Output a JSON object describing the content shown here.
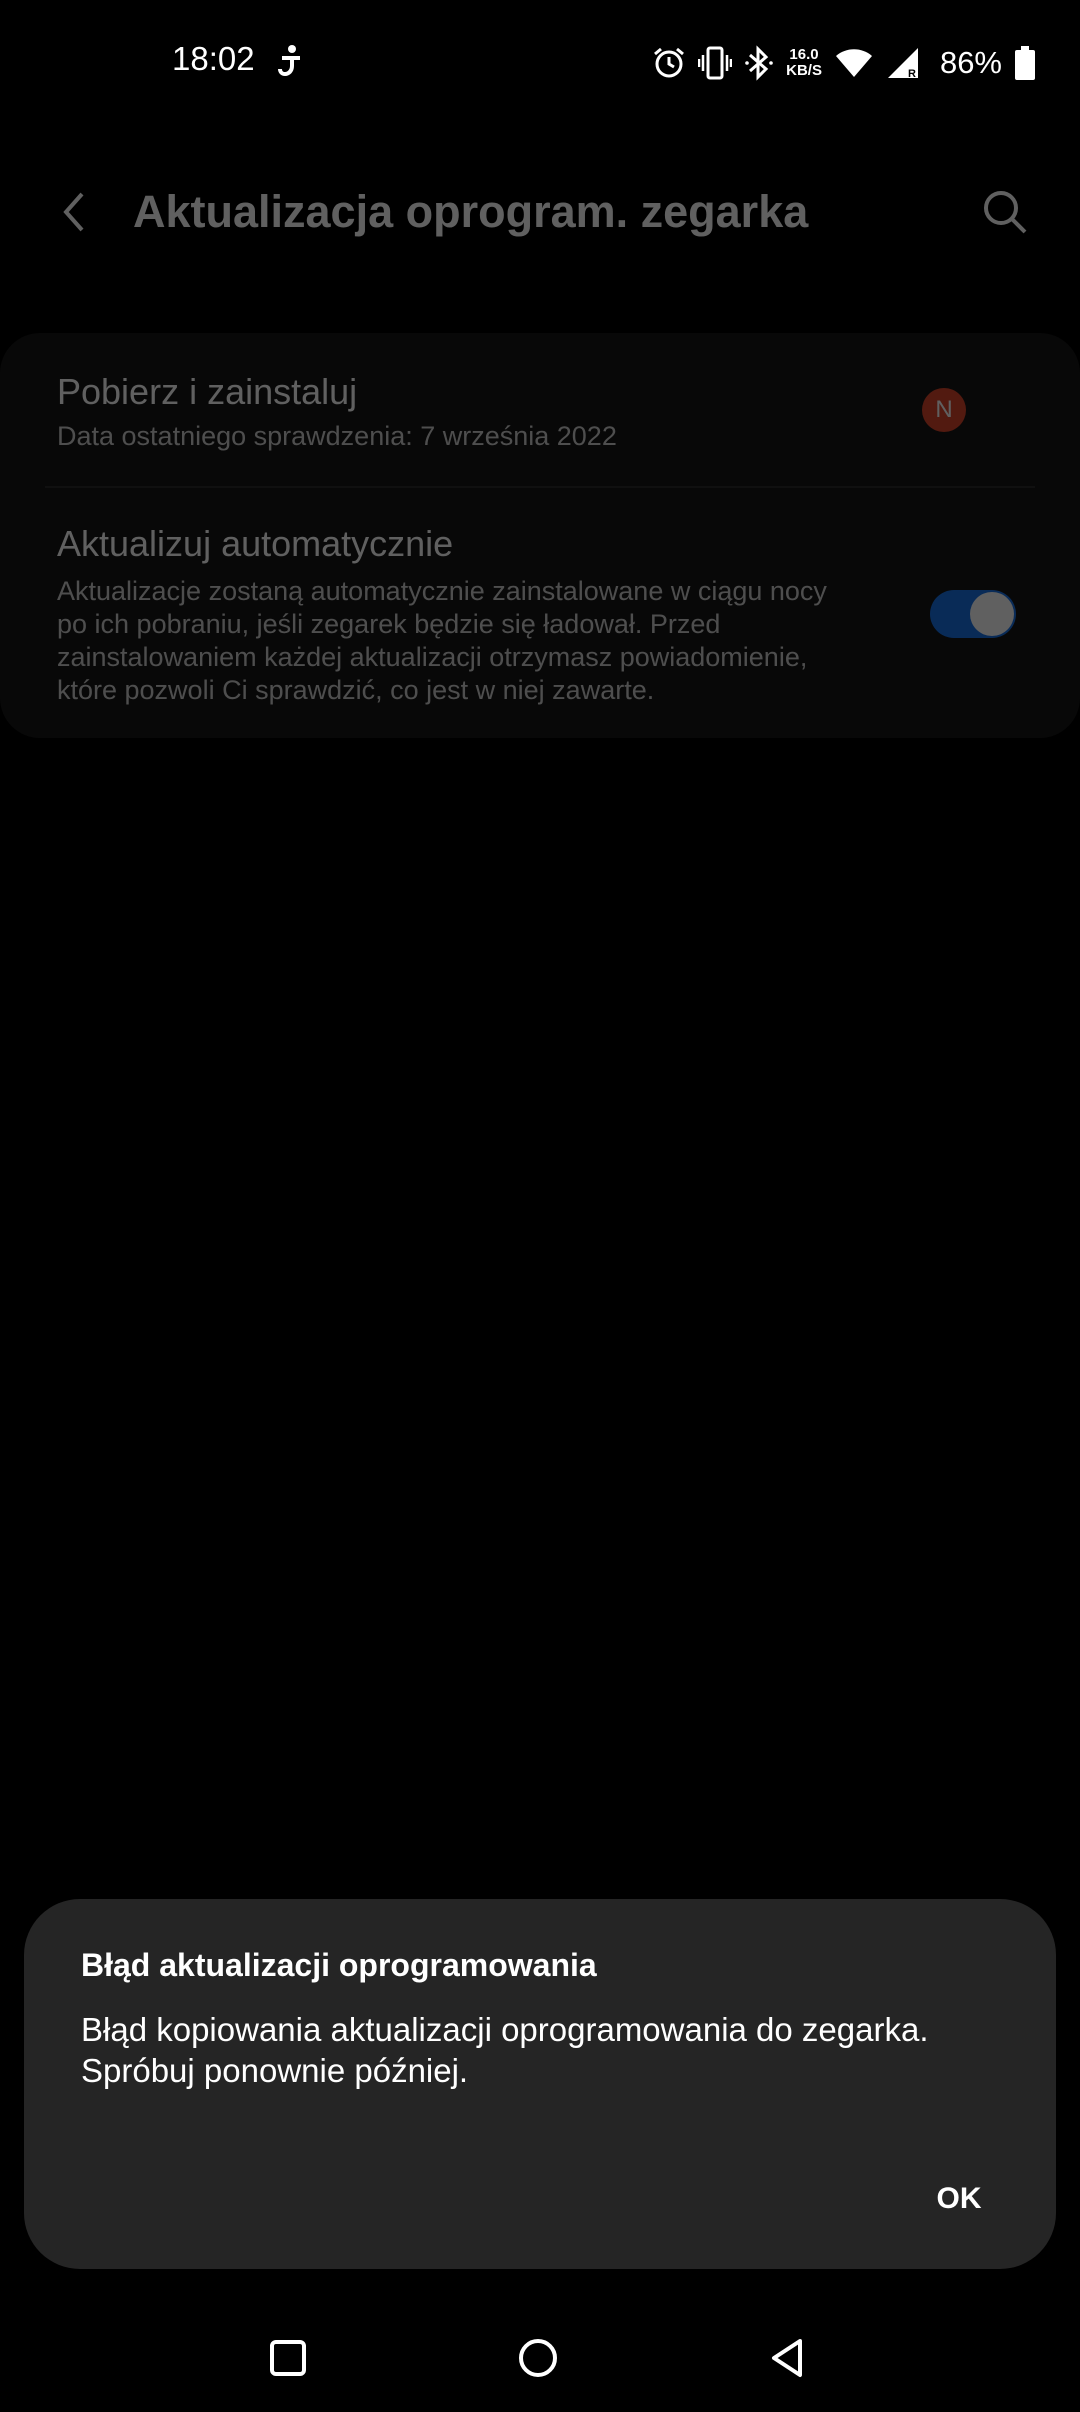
{
  "status_bar": {
    "time": "18:02",
    "net_speed_value": "16.0",
    "net_speed_unit": "KB/S",
    "battery_percent": "86%",
    "icons": [
      "accessibility-icon",
      "alarm-icon",
      "vibrate-icon",
      "bluetooth-icon",
      "wifi-icon",
      "cell-signal-icon",
      "battery-icon"
    ]
  },
  "header": {
    "title": "Aktualizacja oprogram. zegarka"
  },
  "settings": {
    "download": {
      "title": "Pobierz i zainstaluj",
      "subtitle": "Data ostatniego sprawdzenia: 7 września 2022",
      "badge": "N"
    },
    "auto_update": {
      "title": "Aktualizuj automatycznie",
      "description": "Aktualizacje zostaną automatycznie zainstalowane w ciągu nocy po ich pobraniu, jeśli zegarek będzie się ładował. Przed zainstalowaniem każdej aktualizacji otrzymasz powiadomienie, które pozwoli Ci sprawdzić, co jest w niej zawarte.",
      "enabled": true
    }
  },
  "dialog": {
    "title": "Błąd aktualizacji oprogramowania",
    "message": "Błąd kopiowania aktualizacji oprogramowania do zegarka. Spróbuj ponownie później.",
    "ok_label": "OK"
  },
  "colors": {
    "accent": "#1a73e8",
    "badge": "#d9472b",
    "dialog_bg": "#252525"
  }
}
